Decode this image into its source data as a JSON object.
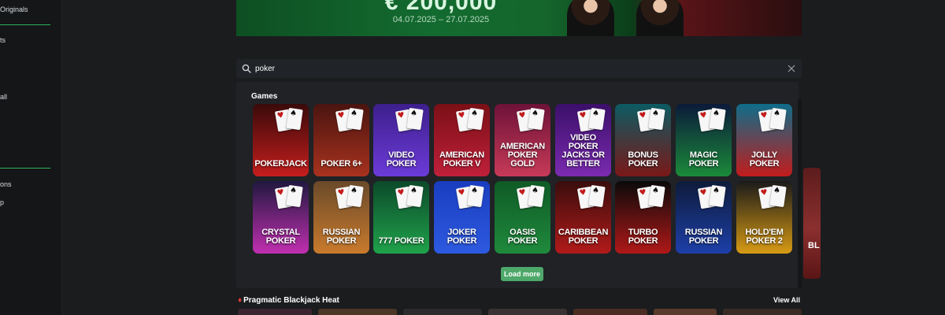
{
  "sidebar": {
    "items": [
      {
        "label": " Originals"
      },
      {
        "label": "ts"
      },
      {
        "label": "all"
      },
      {
        "label": "ons"
      },
      {
        "label": "p"
      }
    ]
  },
  "banner": {
    "amount": "€ 200,000",
    "dates": "04.07.2025 – 27.07.2025"
  },
  "search": {
    "value": "poker",
    "clear_icon": "close-icon",
    "search_icon": "search-icon"
  },
  "results": {
    "heading": "Games",
    "load_more_label": "Load more",
    "games": [
      {
        "title": "POKERJACK",
        "bg": "#3a0a0a",
        "accent": "#c51d1d"
      },
      {
        "title": "POKER 6+",
        "bg": "#4a1410",
        "accent": "#a8321e"
      },
      {
        "title": "VIDEO POKER",
        "bg": "#3d1f8c",
        "accent": "#6c3bd9"
      },
      {
        "title": "AMERICAN POKER V",
        "bg": "#7a0f16",
        "accent": "#c0203a"
      },
      {
        "title": "AMERICAN POKER GOLD",
        "bg": "#6e1238",
        "accent": "#c73a58"
      },
      {
        "title": "VIDEO POKER JACKS OR BETTER",
        "bg": "#3b0f6a",
        "accent": "#7b2bb0"
      },
      {
        "title": "BONUS POKER",
        "bg": "#0c5b63",
        "accent": "#7a1818"
      },
      {
        "title": "MAGIC POKER",
        "bg": "#0b1a3a",
        "accent": "#1b8a3a"
      },
      {
        "title": "JOLLY POKER",
        "bg": "#0e6d8a",
        "accent": "#c21c1c"
      },
      {
        "title": "CRYSTAL POKER",
        "bg": "#20183f",
        "accent": "#c02fb0"
      },
      {
        "title": "RUSSIAN POKER",
        "bg": "#6a4a2a",
        "accent": "#c97a2c"
      },
      {
        "title": "777 POKER",
        "bg": "#0c4a2a",
        "accent": "#1fa24a"
      },
      {
        "title": "JOKER POKER",
        "bg": "#1a3dbf",
        "accent": "#2d5ae0"
      },
      {
        "title": "OASIS POKER",
        "bg": "#0f5a26",
        "accent": "#1f8a3c"
      },
      {
        "title": "CARIBBEAN POKER",
        "bg": "#3a0d0d",
        "accent": "#b21a1a"
      },
      {
        "title": "TURBO POKER",
        "bg": "#0a0a0a",
        "accent": "#b01818"
      },
      {
        "title": "RUSSIAN POKER",
        "bg": "#0e1b3a",
        "accent": "#1d3fa8"
      },
      {
        "title": "HOLD'EM POKER 2",
        "bg": "#1a1a1a",
        "accent": "#d79a14"
      }
    ]
  },
  "side_thumb": {
    "label": "BL"
  },
  "section": {
    "title": "Pragmatic Blackjack Heat",
    "view_all_label": "View All"
  },
  "colors": {
    "accent_green": "#2fb35a",
    "load_more_bg": "#4ea86a"
  }
}
